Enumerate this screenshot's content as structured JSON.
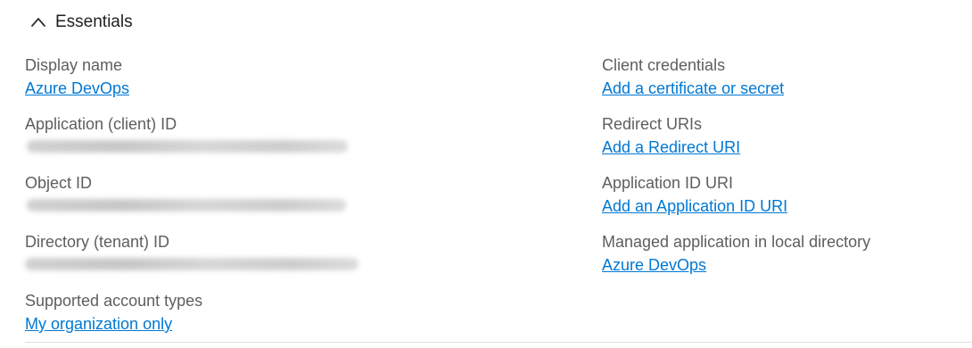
{
  "header": {
    "title": "Essentials",
    "icon": "chevron-up-icon"
  },
  "left_fields": [
    {
      "label": "Display name",
      "value": "Azure DevOps",
      "kind": "link"
    },
    {
      "label": "Application (client) ID",
      "value": "",
      "kind": "redacted"
    },
    {
      "label": "Object ID",
      "value": "",
      "kind": "redacted"
    },
    {
      "label": "Directory (tenant) ID",
      "value": "",
      "kind": "redacted"
    },
    {
      "label": "Supported account types",
      "value": "My organization only",
      "kind": "link"
    }
  ],
  "right_fields": [
    {
      "label": "Client credentials",
      "value": "Add a certificate or secret",
      "kind": "link"
    },
    {
      "label": "Redirect URIs",
      "value": "Add a Redirect URI",
      "kind": "link"
    },
    {
      "label": "Application ID URI",
      "value": "Add an Application ID URI",
      "kind": "link"
    },
    {
      "label": "Managed application in local directory",
      "value": "Azure DevOps",
      "kind": "link"
    }
  ],
  "colors": {
    "link": "#0078d4",
    "label": "#605e5c",
    "title": "#201f1e",
    "divider": "#e1dfdd"
  }
}
